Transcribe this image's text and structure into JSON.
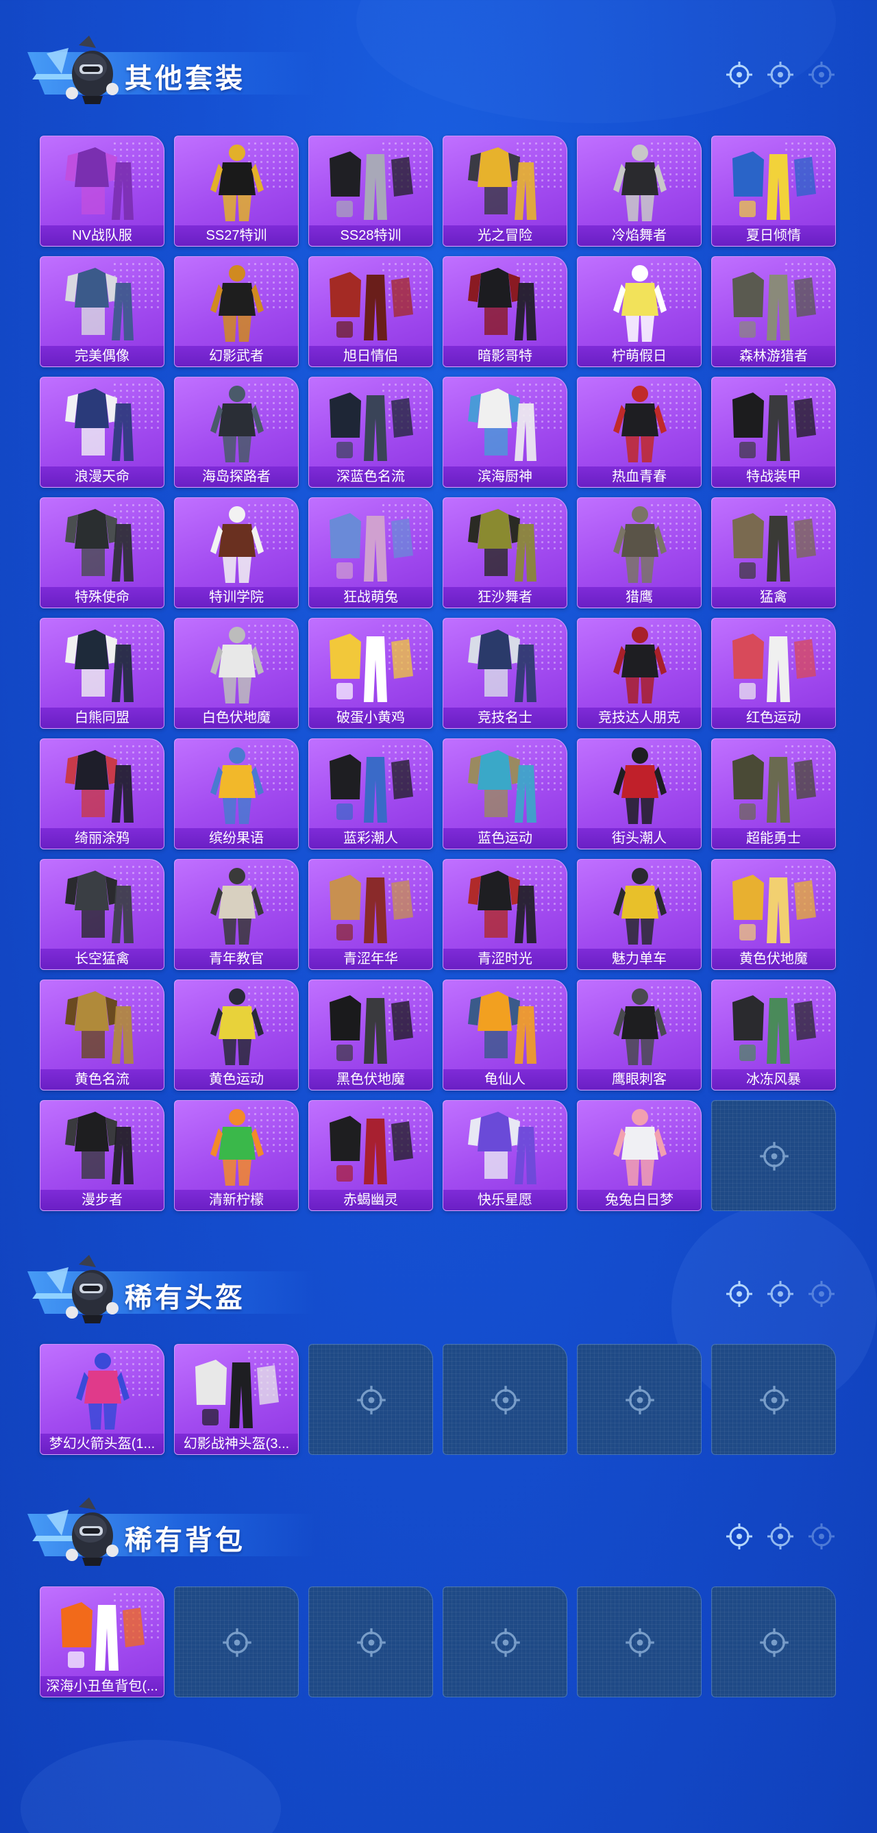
{
  "sections": [
    {
      "title": "其他套装",
      "items": [
        {
          "label": "NV战队服",
          "palette": [
            "#7a2fb0",
            "#c04fe0"
          ]
        },
        {
          "label": "SS27特训",
          "palette": [
            "#1a1a1a",
            "#e2b02a"
          ]
        },
        {
          "label": "SS28特训",
          "palette": [
            "#1f1f24",
            "#a8a8b8"
          ]
        },
        {
          "label": "光之冒险",
          "palette": [
            "#e7b22c",
            "#3a3a44"
          ]
        },
        {
          "label": "冷焰舞者",
          "palette": [
            "#2a2a2e",
            "#c8c8c8"
          ]
        },
        {
          "label": "夏日倾情",
          "palette": [
            "#2a64c8",
            "#f2d23a"
          ]
        },
        {
          "label": "完美偶像",
          "palette": [
            "#3b5a8a",
            "#d8d8e0"
          ]
        },
        {
          "label": "幻影武者",
          "palette": [
            "#1e1e1e",
            "#d08a20"
          ]
        },
        {
          "label": "旭日情侣",
          "palette": [
            "#a42a24",
            "#6a1e1a"
          ]
        },
        {
          "label": "暗影哥特",
          "palette": [
            "#1c1c20",
            "#8a1a22"
          ]
        },
        {
          "label": "柠萌假日",
          "palette": [
            "#f2e25a",
            "#ffffff"
          ]
        },
        {
          "label": "森林游猎者",
          "palette": [
            "#5a5a50",
            "#8a8a7a"
          ]
        },
        {
          "label": "浪漫天命",
          "palette": [
            "#2a3a7a",
            "#f0f0f4"
          ]
        },
        {
          "label": "海岛探路者",
          "palette": [
            "#2a2e36",
            "#4a5a6a"
          ]
        },
        {
          "label": "深蓝色名流",
          "palette": [
            "#1e2636",
            "#3a4458"
          ]
        },
        {
          "label": "滨海厨神",
          "palette": [
            "#f0f0f0",
            "#4a9ad8"
          ]
        },
        {
          "label": "热血青春",
          "palette": [
            "#1e1e22",
            "#c02a2a"
          ]
        },
        {
          "label": "特战装甲",
          "palette": [
            "#1c1c1e",
            "#3a3a3e"
          ]
        },
        {
          "label": "特殊使命",
          "palette": [
            "#2a2e30",
            "#4a4e50"
          ]
        },
        {
          "label": "特训学院",
          "palette": [
            "#6a3020",
            "#f2f2f2"
          ]
        },
        {
          "label": "狂战萌兔",
          "palette": [
            "#6a8ad8",
            "#d0a0d0"
          ]
        },
        {
          "label": "狂沙舞者",
          "palette": [
            "#8a8a30",
            "#2a2a24"
          ]
        },
        {
          "label": "猎鹰",
          "palette": [
            "#5a5448",
            "#7a7466"
          ]
        },
        {
          "label": "猛禽",
          "palette": [
            "#7a6a50",
            "#3a3a36"
          ]
        },
        {
          "label": "白熊同盟",
          "palette": [
            "#1e2a3a",
            "#f0f0f0"
          ]
        },
        {
          "label": "白色伏地魔",
          "palette": [
            "#e8e8e8",
            "#bcbcbc"
          ]
        },
        {
          "label": "破蛋小黄鸡",
          "palette": [
            "#f2c83a",
            "#ffffff"
          ]
        },
        {
          "label": "竞技名士",
          "palette": [
            "#2a3a6a",
            "#d8dce8"
          ]
        },
        {
          "label": "竞技达人朋克",
          "palette": [
            "#1e1e22",
            "#a8202a"
          ]
        },
        {
          "label": "红色运动",
          "palette": [
            "#d84a5a",
            "#f0f0f0"
          ]
        },
        {
          "label": "绮丽涂鸦",
          "palette": [
            "#1e1e2a",
            "#c83a4a"
          ]
        },
        {
          "label": "缤纷果语",
          "palette": [
            "#f2b82a",
            "#4a7ad0"
          ]
        },
        {
          "label": "蓝彩潮人",
          "palette": [
            "#1e1e22",
            "#3a6ac8"
          ]
        },
        {
          "label": "蓝色运动",
          "palette": [
            "#3aa8c8",
            "#9a8a60"
          ]
        },
        {
          "label": "街头潮人",
          "palette": [
            "#c0202a",
            "#1e1e22"
          ]
        },
        {
          "label": "超能勇士",
          "palette": [
            "#4a4a36",
            "#6a6a50"
          ]
        },
        {
          "label": "长空猛禽",
          "palette": [
            "#3a3e44",
            "#2a2a2e"
          ]
        },
        {
          "label": "青年教官",
          "palette": [
            "#d8d0c0",
            "#3a3a3a"
          ]
        },
        {
          "label": "青涩年华",
          "palette": [
            "#c89050",
            "#8a2a2a"
          ]
        },
        {
          "label": "青涩时光",
          "palette": [
            "#1e1e22",
            "#b02a2a"
          ]
        },
        {
          "label": "魅力单车",
          "palette": [
            "#e8c02a",
            "#2a2a30"
          ]
        },
        {
          "label": "黄色伏地魔",
          "palette": [
            "#e8b030",
            "#f2d070"
          ]
        },
        {
          "label": "黄色名流",
          "palette": [
            "#b08a3a",
            "#6a4a20"
          ]
        },
        {
          "label": "黄色运动",
          "palette": [
            "#e8d23a",
            "#2a2a3a"
          ]
        },
        {
          "label": "黑色伏地魔",
          "palette": [
            "#1a1a1c",
            "#3a3a3e"
          ]
        },
        {
          "label": "龟仙人",
          "palette": [
            "#f2a020",
            "#3a5a8a"
          ]
        },
        {
          "label": "鹰眼刺客",
          "palette": [
            "#1e1e20",
            "#4a4a50"
          ]
        },
        {
          "label": "冰冻风暴",
          "palette": [
            "#2a2a2e",
            "#4a8a5a"
          ]
        },
        {
          "label": "漫步者",
          "palette": [
            "#1e1e20",
            "#3a3a3e"
          ]
        },
        {
          "label": "清新柠檬",
          "palette": [
            "#3ab84a",
            "#f28a2a"
          ]
        },
        {
          "label": "赤蝎幽灵",
          "palette": [
            "#1e1e20",
            "#a82030"
          ]
        },
        {
          "label": "快乐星愿",
          "palette": [
            "#6a4ad8",
            "#e8e8f4"
          ]
        },
        {
          "label": "兔兔白日梦",
          "palette": [
            "#f0f0f4",
            "#f2a0b0"
          ]
        },
        null
      ]
    },
    {
      "title": "稀有头盔",
      "items": [
        {
          "label": "梦幻火箭头盔(1...",
          "palette": [
            "#e03a8a",
            "#3a4ad8"
          ]
        },
        {
          "label": "幻影战神头盔(3...",
          "palette": [
            "#e8e8e8",
            "#1e1e22"
          ]
        },
        null,
        null,
        null,
        null
      ]
    },
    {
      "title": "稀有背包",
      "items": [
        {
          "label": "深海小丑鱼背包(...",
          "palette": [
            "#f26a1a",
            "#ffffff"
          ]
        },
        null,
        null,
        null,
        null,
        null
      ]
    }
  ],
  "icons": {
    "section_mascot": "mascot-helmet-icon",
    "corner_decoration": "crosshair-icon",
    "empty_slot": "crosshair-icon"
  },
  "colors": {
    "background": "#1550d2",
    "card_purple": "#a24bf0",
    "label_bar": "#6a1fc4",
    "empty_slot": "#1f4a86"
  }
}
